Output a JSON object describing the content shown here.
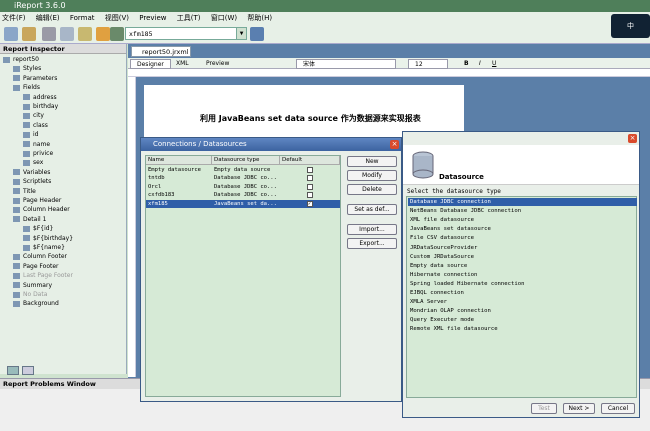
{
  "app": {
    "title": "iReport 3.6.0"
  },
  "menu": [
    "文件(F)",
    "编辑(E)",
    "Format",
    "视图(V)",
    "Preview",
    "工具(T)",
    "窗口(W)",
    "帮助(H)"
  ],
  "toolbar": {
    "datasource_value": "xfm185"
  },
  "tray": {
    "label": "中"
  },
  "inspector": {
    "title": "Report Inspector",
    "items": [
      {
        "label": "report50",
        "depth": 0
      },
      {
        "label": "Styles",
        "depth": 1
      },
      {
        "label": "Parameters",
        "depth": 1
      },
      {
        "label": "Fields",
        "depth": 1
      },
      {
        "label": "address",
        "depth": 2
      },
      {
        "label": "birthday",
        "depth": 2
      },
      {
        "label": "city",
        "depth": 2
      },
      {
        "label": "class",
        "depth": 2
      },
      {
        "label": "id",
        "depth": 2
      },
      {
        "label": "name",
        "depth": 2
      },
      {
        "label": "privice",
        "depth": 2
      },
      {
        "label": "sex",
        "depth": 2
      },
      {
        "label": "Variables",
        "depth": 1
      },
      {
        "label": "Scriptlets",
        "depth": 1
      },
      {
        "label": "Title",
        "depth": 1
      },
      {
        "label": "Page Header",
        "depth": 1
      },
      {
        "label": "Column Header",
        "depth": 1
      },
      {
        "label": "Detail 1",
        "depth": 1
      },
      {
        "label": "$F{id}",
        "depth": 2
      },
      {
        "label": "$F{birthday}",
        "depth": 2
      },
      {
        "label": "$F{name}",
        "depth": 2
      },
      {
        "label": "Column Footer",
        "depth": 1
      },
      {
        "label": "Page Footer",
        "depth": 1
      },
      {
        "label": "Last Page Footer",
        "depth": 1,
        "dim": true
      },
      {
        "label": "Summary",
        "depth": 1
      },
      {
        "label": "No Data",
        "depth": 1,
        "dim": true
      },
      {
        "label": "Background",
        "depth": 1
      }
    ]
  },
  "problems": {
    "title": "Report Problems Window"
  },
  "editor": {
    "doc_tab": "report50.jrxml",
    "tabs": [
      "Designer",
      "XML",
      "Preview"
    ],
    "font_select": "宋体",
    "size_select": "12",
    "report_title": "利用 JavaBeans set data source 作为数据源来实现报表"
  },
  "connections": {
    "title": "Connections / Datasources",
    "headers": [
      "Name",
      "Datasource type",
      "Default"
    ],
    "rows": [
      {
        "name": "Empty datasource",
        "type": "Empty data source",
        "default": false
      },
      {
        "name": "tntdb",
        "type": "Database JDBC co...",
        "default": false
      },
      {
        "name": "Orcl",
        "type": "Database JDBC co...",
        "default": false
      },
      {
        "name": "cxfdb183",
        "type": "Database JDBC co...",
        "default": false
      },
      {
        "name": "xfm185",
        "type": "JavaBeans set da...",
        "default": true,
        "selected": true
      }
    ],
    "buttons": [
      "New",
      "Modify",
      "Delete",
      "Set as def...",
      "Import...",
      "Export..."
    ]
  },
  "datasource": {
    "title": "Datasource",
    "prompt": "Select the datasource type",
    "types": [
      "Database JDBC connection",
      "NetBeans Database JDBC connection",
      "XML file datasource",
      "JavaBeans set datasource",
      "File CSV datasource",
      "JRDataSourceProvider",
      "Custom JRDataSource",
      "Empty data source",
      "Hibernate connection",
      "Spring loaded Hibernate connection",
      "EJBQL connection",
      "XMLA Server",
      "Mondrian OLAP connection",
      "Query Executer mode",
      "Remote XML file datasource"
    ],
    "selected_index": 0,
    "buttons": {
      "test": "Test",
      "next": "Next >",
      "cancel": "Cancel"
    }
  }
}
